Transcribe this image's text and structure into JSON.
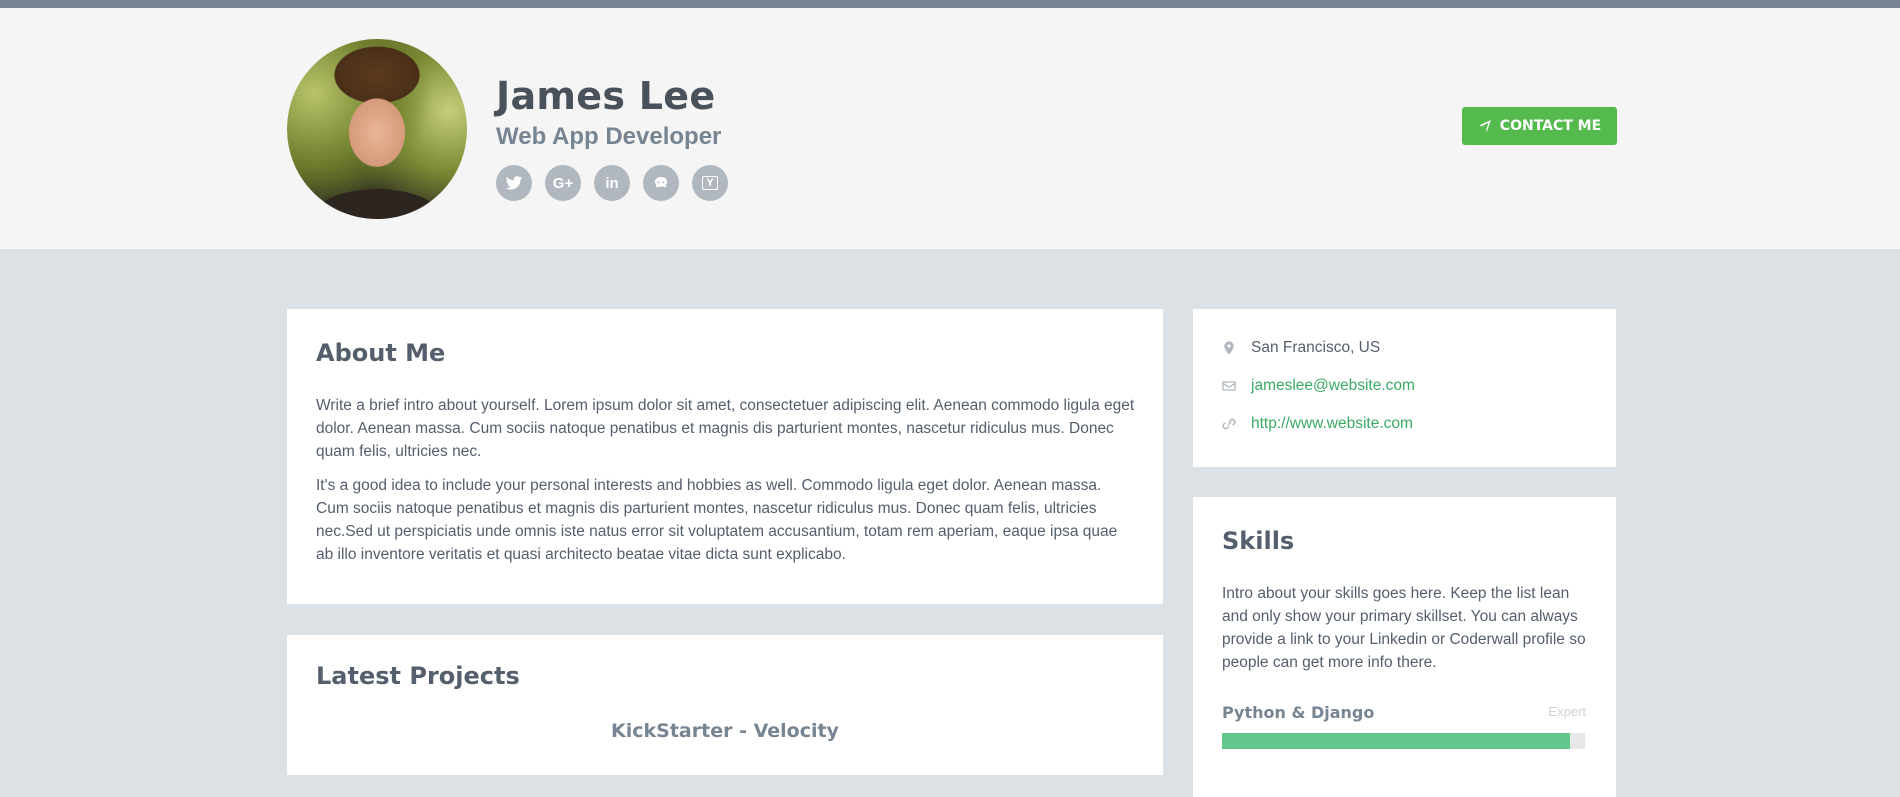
{
  "profile": {
    "name": "James Lee",
    "title": "Web App Developer",
    "contact_label": "CONTACT ME"
  },
  "social": [
    {
      "icon": "twitter-icon"
    },
    {
      "icon": "google-plus-icon",
      "label": "G+"
    },
    {
      "icon": "linkedin-icon",
      "label": "in"
    },
    {
      "icon": "github-icon"
    },
    {
      "icon": "hacker-news-icon",
      "label": "Y"
    }
  ],
  "about": {
    "heading": "About Me",
    "p1": "Write a brief intro about yourself. Lorem ipsum dolor sit amet, consectetuer adipiscing elit. Aenean commodo ligula eget dolor. Aenean massa. Cum sociis natoque penatibus et magnis dis parturient montes, nascetur ridiculus mus. Donec quam felis, ultricies nec.",
    "p2": "It's a good idea to include your personal interests and hobbies as well. Commodo ligula eget dolor. Aenean massa. Cum sociis natoque penatibus et magnis dis parturient montes, nascetur ridiculus mus. Donec quam felis, ultricies nec.Sed ut perspiciatis unde omnis iste natus error sit voluptatem accusantium, totam rem aperiam, eaque ipsa quae ab illo inventore veritatis et quasi architecto beatae vitae dicta sunt explicabo."
  },
  "projects": {
    "heading": "Latest Projects",
    "first_title": "KickStarter - Velocity"
  },
  "info": {
    "location": "San Francisco, US",
    "email": "jameslee@website.com",
    "website": "http://www.website.com"
  },
  "skills": {
    "heading": "Skills",
    "intro": "Intro about your skills goes here. Keep the list lean and only show your primary skillset. You can always provide a link to your Linkedin or Coderwall profile so people can get more info there.",
    "items": [
      {
        "name": "Python & Django",
        "level": "Expert",
        "percent": 96
      }
    ]
  },
  "colors": {
    "accent_green": "#54ba4e",
    "link_green": "#3aaa64",
    "skill_bar": "#63c78d",
    "background": "#dbe1e5"
  }
}
